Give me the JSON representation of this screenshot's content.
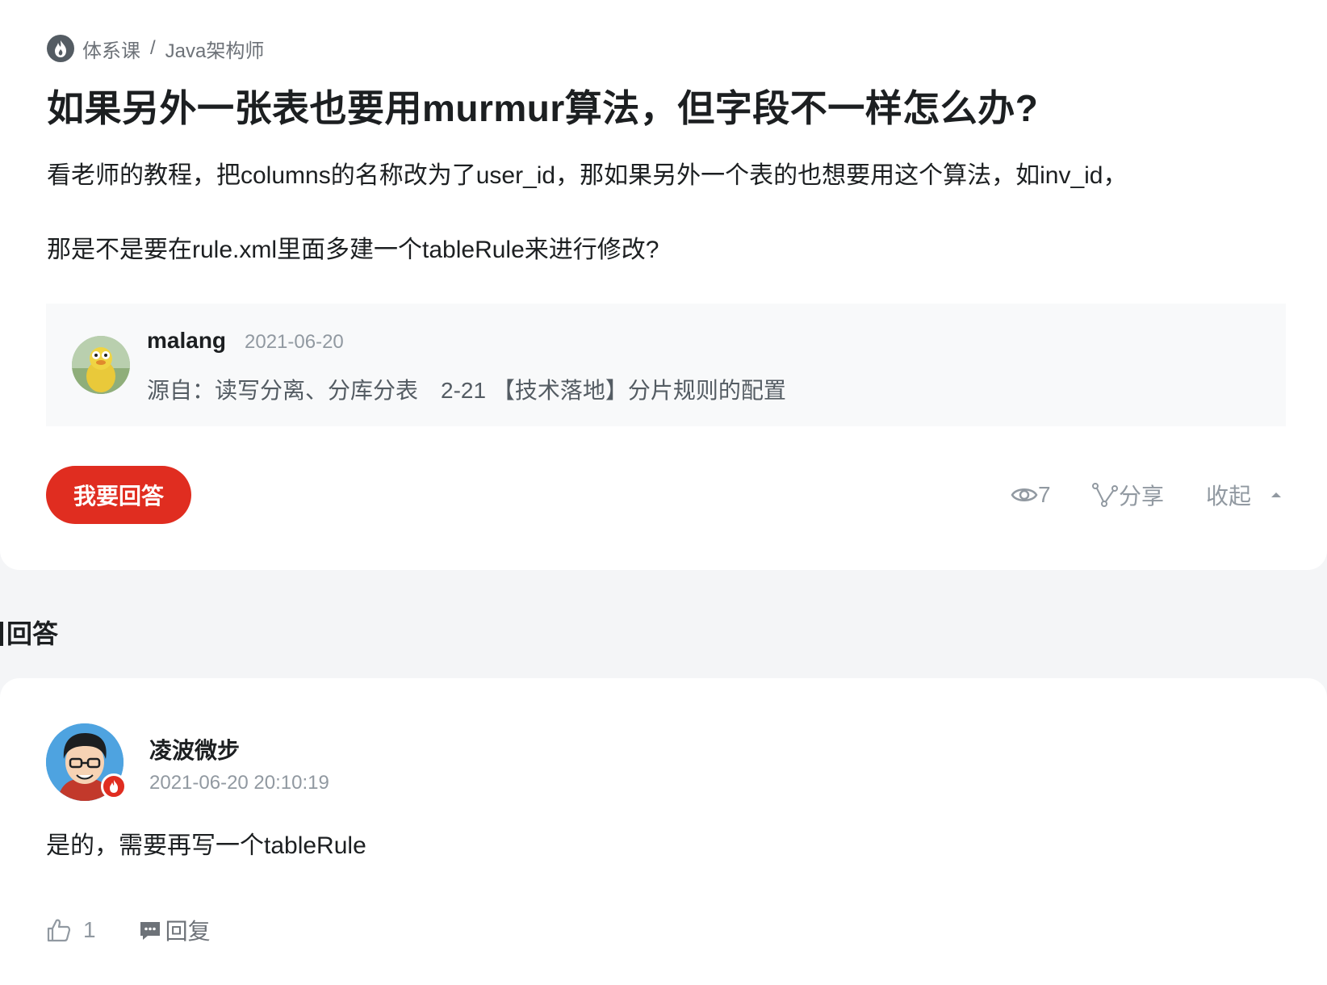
{
  "breadcrumb": {
    "category": "体系课",
    "separator": "/",
    "course": "Java架构师"
  },
  "question": {
    "title": "如果另外一张表也要用murmur算法，但字段不一样怎么办?",
    "body_line1": "看老师的教程，把columns的名称改为了user_id，那如果另外一个表的也想要用这个算法，如inv_id，",
    "body_line2": "那是不是要在rule.xml里面多建一个tableRule来进行修改?"
  },
  "meta": {
    "author": "malang",
    "date": "2021-06-20",
    "source": "源自：读写分离、分库分表　2-21 【技术落地】分片规则的配置"
  },
  "actions": {
    "answer_button": "我要回答",
    "views": "7",
    "share": "分享",
    "collapse": "收起"
  },
  "section_label": "回答",
  "answer": {
    "author": "凌波微步",
    "datetime": "2021-06-20 20:10:19",
    "content": "是的，需要再写一个tableRule",
    "likes": "1",
    "reply": "回复"
  },
  "colors": {
    "accent": "#e02d20",
    "muted": "#9199a1",
    "text": "#1c1f21",
    "meta_bg": "#f8f9fa"
  },
  "icons": [
    "logo-flame-icon",
    "eye-icon",
    "share-icon",
    "caret-up-icon",
    "thumbs-up-icon",
    "comment-icon",
    "flame-badge-icon"
  ]
}
